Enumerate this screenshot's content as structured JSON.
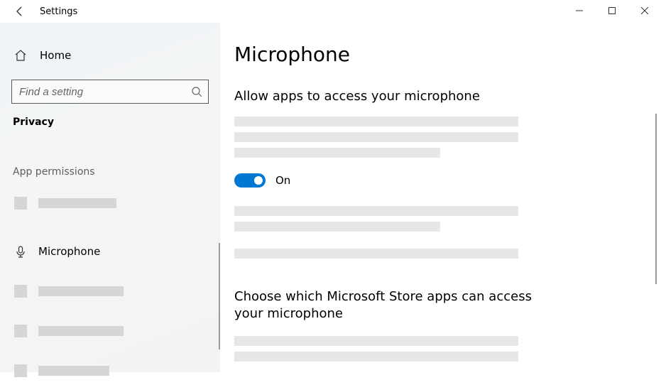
{
  "window": {
    "title": "Settings"
  },
  "sidebar": {
    "home_label": "Home",
    "search_placeholder": "Find a setting",
    "category_label": "Privacy",
    "section_label": "App permissions",
    "microphone_label": "Microphone"
  },
  "main": {
    "page_title": "Microphone",
    "heading_allow": "Allow apps to access your microphone",
    "toggle_state_label": "On",
    "heading_choose": "Choose which Microsoft Store apps can access your microphone"
  }
}
